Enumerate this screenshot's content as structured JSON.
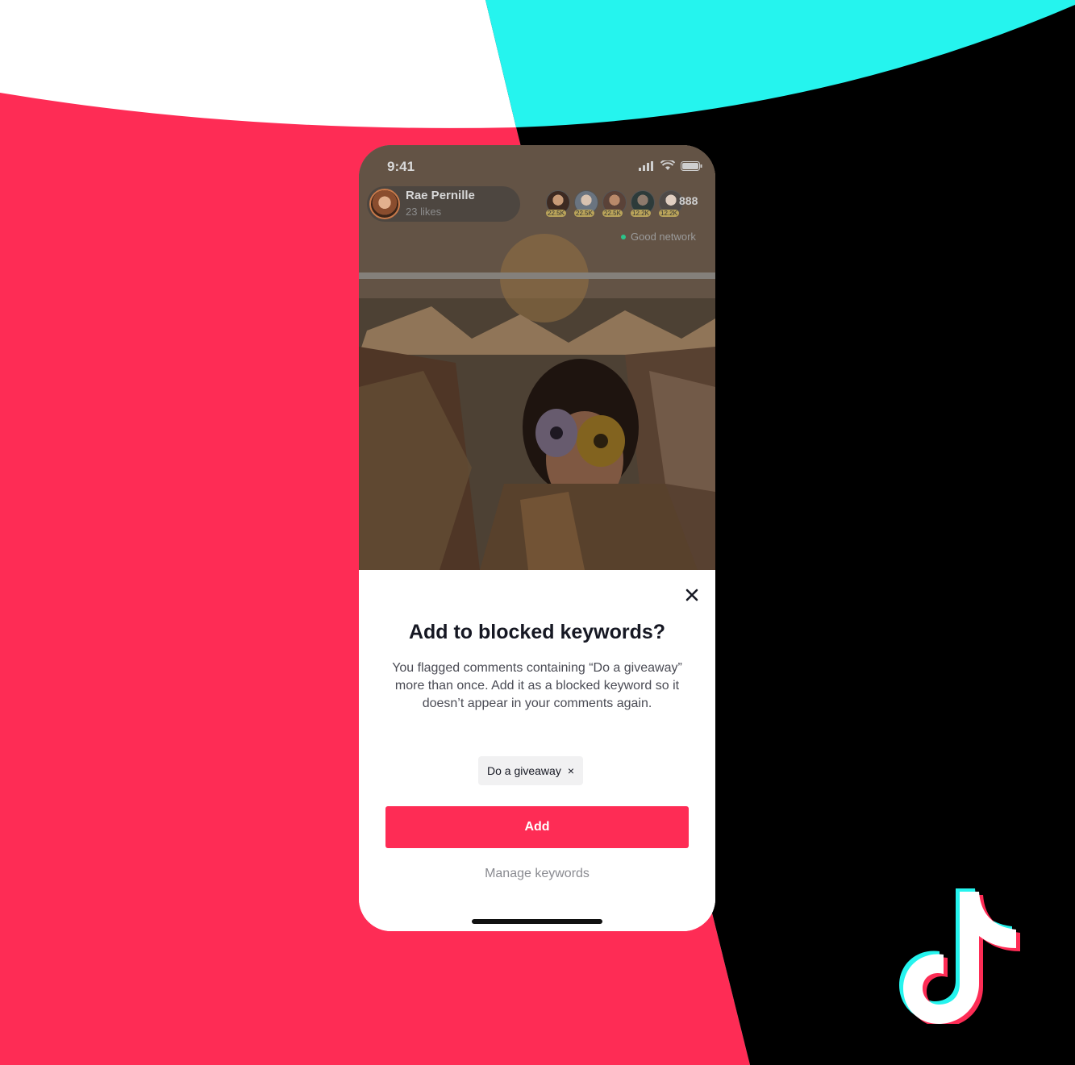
{
  "colors": {
    "brand_red": "#fe2c55",
    "brand_cyan": "#25f4ee",
    "black": "#000000",
    "white": "#ffffff"
  },
  "status_bar": {
    "time": "9:41",
    "icons": [
      "signal-icon",
      "wifi-icon",
      "battery-icon"
    ]
  },
  "live": {
    "host_name": "Rae Pernille",
    "host_likes": "23 likes",
    "viewers": [
      {
        "count": "22.5K"
      },
      {
        "count": "22.5K"
      },
      {
        "count": "22.5K"
      },
      {
        "count": "12.2K"
      },
      {
        "count": "12.2K"
      }
    ],
    "viewer_total": "888",
    "network_status": "Good network"
  },
  "dialog": {
    "title": "Add to blocked keywords?",
    "description": "You flagged comments containing “Do a giveaway” more than once. Add it as a blocked keyword so it doesn’t appear in your comments again.",
    "keyword_chip": "Do a giveaway",
    "chip_remove": "×",
    "add_label": "Add",
    "manage_label": "Manage keywords"
  },
  "logo": {
    "icon": "tiktok-logo-icon"
  }
}
